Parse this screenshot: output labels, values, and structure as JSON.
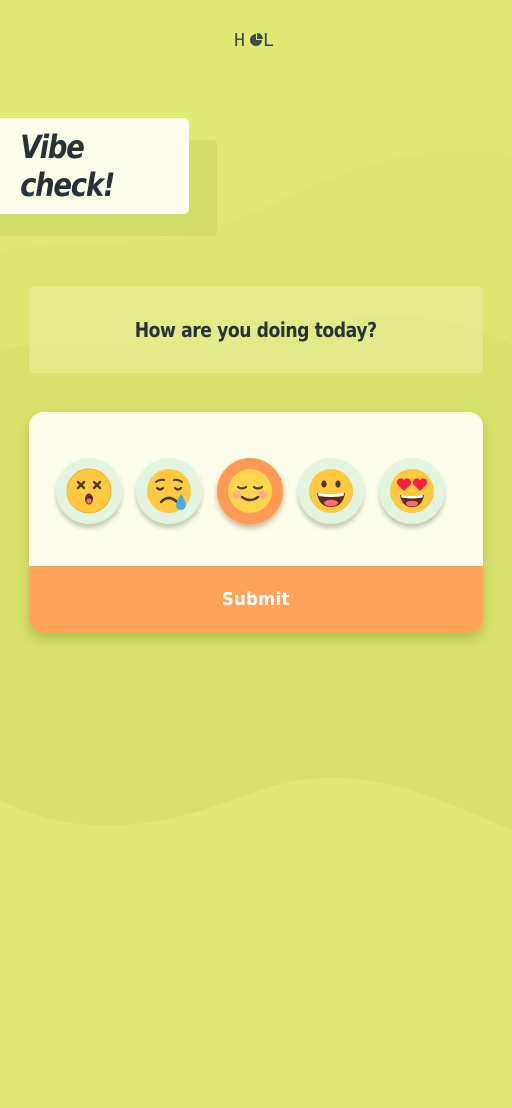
{
  "logo": {
    "left": "H",
    "right": "L",
    "middle_icon": "circle-pie-icon"
  },
  "title": "Vibe check!",
  "question": "How are you doing today?",
  "moods": [
    {
      "icon": "dizzy-face-icon",
      "selected": false
    },
    {
      "icon": "sad-tear-face-icon",
      "selected": false
    },
    {
      "icon": "content-smile-face-icon",
      "selected": true
    },
    {
      "icon": "grinning-face-icon",
      "selected": false
    },
    {
      "icon": "heart-eyes-face-icon",
      "selected": false
    }
  ],
  "submit_label": "Submit",
  "colors": {
    "background": "#dfea74",
    "card": "#fdffea",
    "accent": "#ffa45a",
    "selected": "#ff9a55",
    "emoji_bg": "#e3f5e0",
    "text": "#263238"
  }
}
